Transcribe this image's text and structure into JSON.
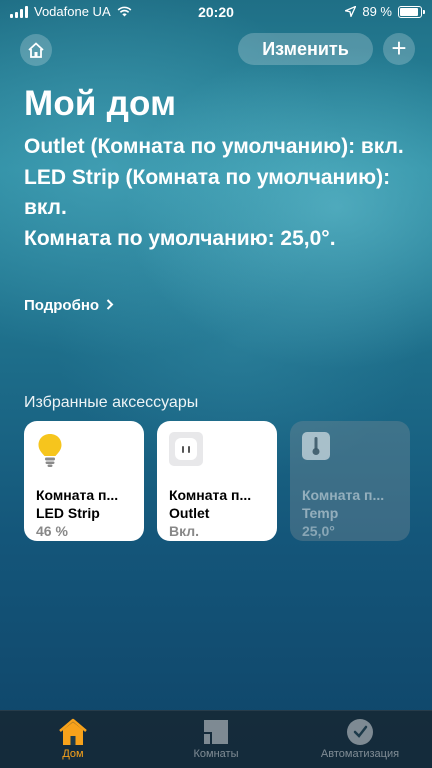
{
  "status_bar": {
    "carrier": "Vodafone UA",
    "time": "20:20",
    "battery_percent": "89 %",
    "battery_level": 0.89
  },
  "header": {
    "edit_label": "Изменить",
    "add_label": "+",
    "title": "Мой дом"
  },
  "summary": {
    "line1": "Outlet (Комната по умолчанию): вкл.",
    "line2": "LED Strip (Комната по умолчанию): вкл.",
    "line3": "Комната по умолчанию: 25,0°."
  },
  "details_label": "Подробно",
  "favorites": {
    "title": "Избранные аксессуары",
    "tiles": [
      {
        "room": "Комната п...",
        "name": "LED Strip",
        "status": "46 %",
        "icon": "lightbulb-icon",
        "active": true
      },
      {
        "room": "Комната п...",
        "name": "Outlet",
        "status": "Вкл.",
        "icon": "outlet-icon",
        "active": true
      },
      {
        "room": "Комната п...",
        "name": "Temp",
        "status": "25,0°",
        "icon": "thermometer-icon",
        "active": false
      }
    ]
  },
  "tab_bar": {
    "tabs": [
      {
        "label": "Дом",
        "icon": "house-icon",
        "selected": true
      },
      {
        "label": "Комнаты",
        "icon": "rooms-icon",
        "selected": false
      },
      {
        "label": "Автоматизация",
        "icon": "clock-icon",
        "selected": false
      }
    ]
  },
  "colors": {
    "accent": "#f7a21b",
    "bulb": "#f6c51d"
  }
}
